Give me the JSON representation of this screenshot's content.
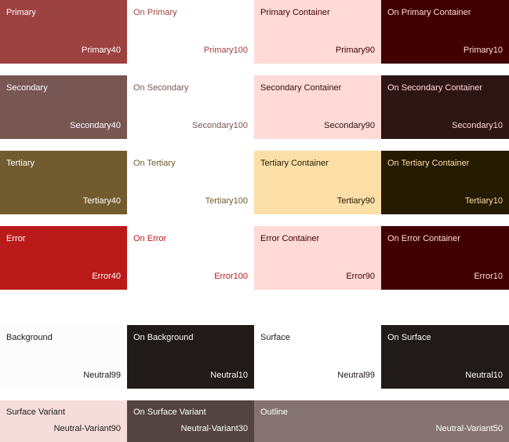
{
  "scheme_rows": [
    [
      {
        "name": "Primary",
        "tone": "Primary40",
        "bg": "#9C4240",
        "fg": "#FFFFFF"
      },
      {
        "name": "On Primary",
        "tone": "Primary100",
        "bg": "#FFFFFF",
        "fg": "#9C4240"
      },
      {
        "name": "Primary Container",
        "tone": "Primary90",
        "bg": "#FFDAD6",
        "fg": "#410002"
      },
      {
        "name": "On Primary Container",
        "tone": "Primary10",
        "bg": "#410002",
        "fg": "#FFDAD6"
      }
    ],
    [
      {
        "name": "Secondary",
        "tone": "Secondary40",
        "bg": "#775654",
        "fg": "#FFFFFF"
      },
      {
        "name": "On Secondary",
        "tone": "Secondary100",
        "bg": "#FFFFFF",
        "fg": "#775654"
      },
      {
        "name": "Secondary Container",
        "tone": "Secondary90",
        "bg": "#FFDAD6",
        "fg": "#2C1513"
      },
      {
        "name": "On Secondary Container",
        "tone": "Secondary10",
        "bg": "#2C1513",
        "fg": "#FFDAD6"
      }
    ],
    [
      {
        "name": "Tertiary",
        "tone": "Tertiary40",
        "bg": "#705C2E",
        "fg": "#FFFFFF"
      },
      {
        "name": "On Tertiary",
        "tone": "Tertiary100",
        "bg": "#FFFFFF",
        "fg": "#705C2E"
      },
      {
        "name": "Tertiary Container",
        "tone": "Tertiary90",
        "bg": "#FCDFA6",
        "fg": "#261A00"
      },
      {
        "name": "On Tertiary Container",
        "tone": "Tertiary10",
        "bg": "#261A00",
        "fg": "#FCDFA6"
      }
    ],
    [
      {
        "name": "Error",
        "tone": "Error40",
        "bg": "#BA1A1A",
        "fg": "#FFFFFF"
      },
      {
        "name": "On Error",
        "tone": "Error100",
        "bg": "#FFFFFF",
        "fg": "#BA1A1A"
      },
      {
        "name": "Error Container",
        "tone": "Error90",
        "bg": "#FFDAD6",
        "fg": "#410002"
      },
      {
        "name": "On Error Container",
        "tone": "Error10",
        "bg": "#410002",
        "fg": "#FFDAD6"
      }
    ]
  ],
  "neutral_row": [
    {
      "name": "Background",
      "tone": "Neutral99",
      "bg": "#FCFCFC",
      "fg": "#201A19"
    },
    {
      "name": "On Background",
      "tone": "Neutral10",
      "bg": "#201A19",
      "fg": "#FCFCFC"
    },
    {
      "name": "Surface",
      "tone": "Neutral99",
      "bg": "#FFFFFF",
      "fg": "#201A19"
    },
    {
      "name": "On Surface",
      "tone": "Neutral10",
      "bg": "#201A19",
      "fg": "#FCFCFC"
    }
  ],
  "variant_row": [
    {
      "name": "Surface Variant",
      "tone": "Neutral-Variant90",
      "bg": "#F5DDDB",
      "fg": "#201A19"
    },
    {
      "name": "On Surface Variant",
      "tone": "Neutral-Variant30",
      "bg": "#534341",
      "fg": "#FFFFFF"
    },
    {
      "name": "Outline",
      "tone": "Neutral-Variant50",
      "bg": "#857371",
      "fg": "#FFFFFF"
    }
  ]
}
